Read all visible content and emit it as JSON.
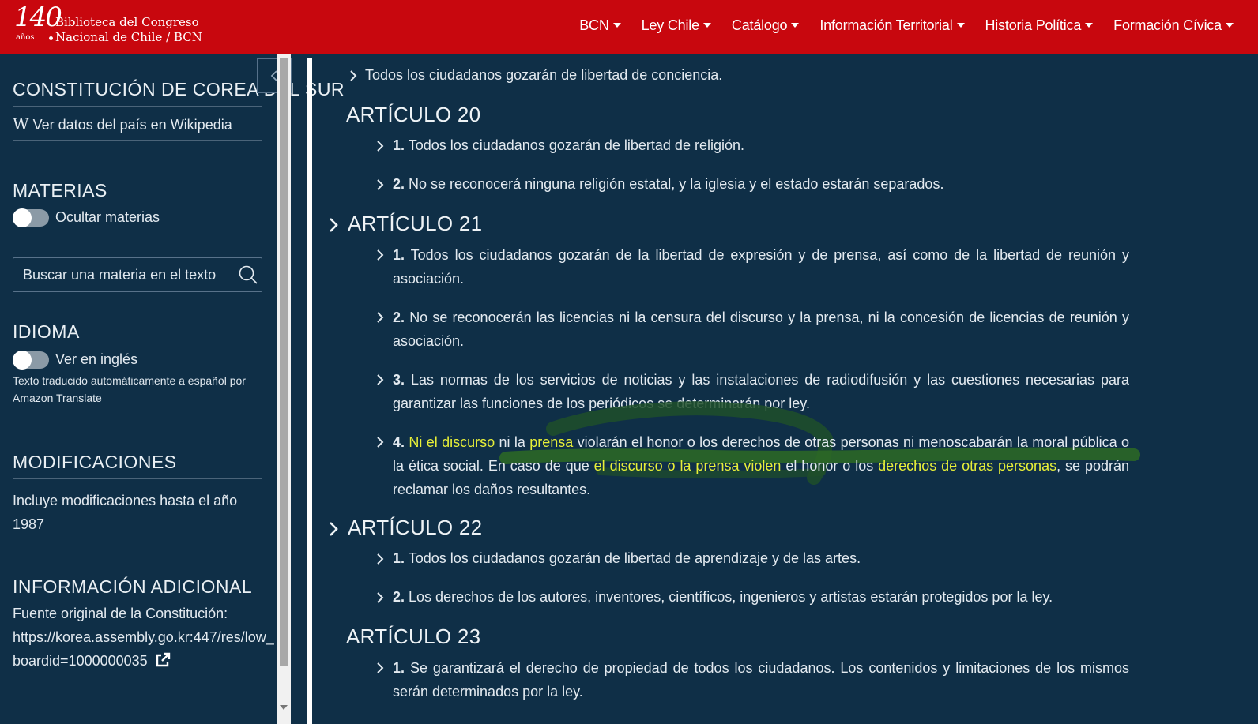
{
  "header": {
    "logo_number": "140",
    "logo_anos": "años",
    "logo_line1": "Biblioteca del Congreso",
    "logo_line2": "Nacional de Chile / BCN",
    "nav": [
      {
        "label": "BCN"
      },
      {
        "label": "Ley Chile"
      },
      {
        "label": "Catálogo"
      },
      {
        "label": "Información Territorial"
      },
      {
        "label": "Historia Política"
      },
      {
        "label": "Formación Cívica"
      }
    ]
  },
  "sidebar": {
    "title": "CONSTITUCIÓN DE COREA DEL SUR",
    "wiki_glyph": "W",
    "wiki_link": "Ver datos del país en Wikipedia",
    "materias_heading": "MATERIAS",
    "materias_toggle_label": "Ocultar materias",
    "search_placeholder": "Buscar una materia en el texto",
    "idioma_heading": "IDIOMA",
    "idioma_toggle_label": "Ver en inglés",
    "translate_note": "Texto traducido automáticamente a español por",
    "translate_provider": "Amazon Translate",
    "modificaciones_heading": "MODIFICACIONES",
    "modificaciones_text": "Incluye modificaciones hasta el año",
    "modificaciones_year": "1987",
    "info_heading": "INFORMACIÓN ADICIONAL",
    "info_source_label": "Fuente original de la Constitución:",
    "info_url_line1": "https://korea.assembly.go.kr:447/res/low_",
    "info_url_line2": "boardid=1000000035"
  },
  "main": {
    "top_item": "Todos los ciudadanos gozarán de libertad de conciencia.",
    "art20": {
      "title": "ARTÍCULO 20",
      "items": [
        {
          "num": "1.",
          "text": "Todos los ciudadanos gozarán de libertad de religión."
        },
        {
          "num": "2.",
          "text": "No se reconocerá ninguna religión estatal, y la iglesia y el estado estarán separados."
        }
      ]
    },
    "art21": {
      "title": "ARTÍCULO 21",
      "item1_num": "1.",
      "item1_text": "Todos los ciudadanos gozarán de la libertad de expresión y de prensa, así como de la libertad de reunión y asociación.",
      "item2_num": "2.",
      "item2_text": "No se reconocerán las licencias ni la censura del discurso y la prensa, ni la concesión de licencias de reunión y asociación.",
      "item3_num": "3.",
      "item3_text": "Las normas de los servicios de noticias y las instalaciones de radiodifusión y las cuestiones necesarias para garantizar las funciones de los periódicos se determinarán por ley.",
      "item4_num": "4.",
      "item4_a": "Ni el discurso",
      "item4_b": " ni la ",
      "item4_c": "prensa",
      "item4_d": " violarán el honor o los derechos de otras personas ni menoscabarán la moral pública o la ética social. En caso de que ",
      "item4_e": "el discurso o la prensa violen",
      "item4_f": " el honor o los ",
      "item4_g": "derechos de otras personas",
      "item4_h": ", se podrán reclamar los daños resultantes."
    },
    "art22": {
      "title": "ARTÍCULO 22",
      "items": [
        {
          "num": "1.",
          "text": "Todos los ciudadanos gozarán de libertad de aprendizaje y de las artes."
        },
        {
          "num": "2.",
          "text": "Los derechos de los autores, inventores, científicos, ingenieros y artistas estarán protegidos por la ley."
        }
      ]
    },
    "art23": {
      "title": "ARTÍCULO 23",
      "item1_num": "1.",
      "item1_text": "Se garantizará el derecho de propiedad de todos los ciudadanos. Los contenidos y limitaciones de los mismos serán determinados por la ley."
    }
  }
}
